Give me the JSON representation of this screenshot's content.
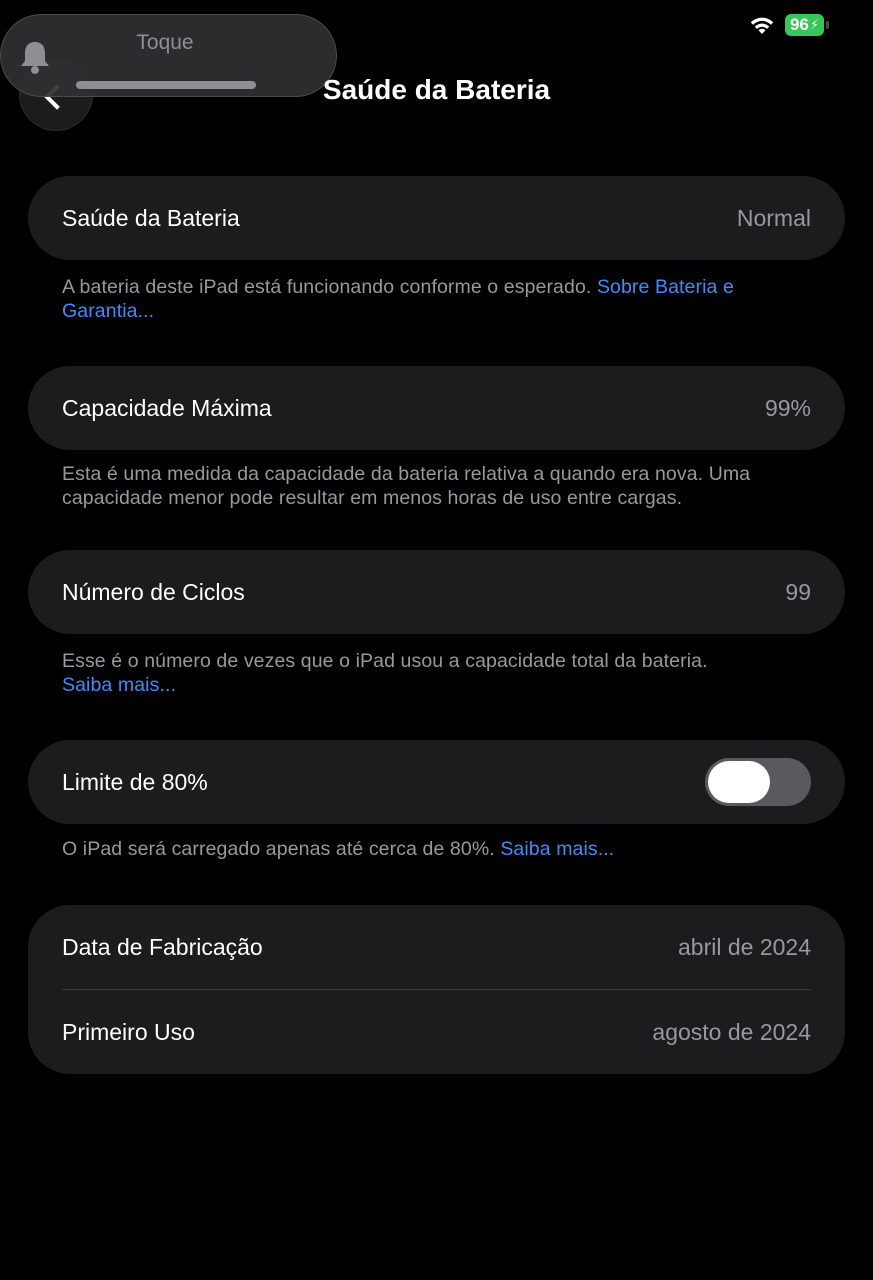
{
  "status_bar": {
    "battery_percent": "96",
    "wifi_icon": "wifi-icon",
    "charging_icon": "bolt-icon"
  },
  "banner": {
    "label": "Toque",
    "icon": "bell-icon",
    "volume_level": 1.0
  },
  "header": {
    "title": "Saúde da Bateria",
    "back_icon": "chevron-left-icon"
  },
  "sections": {
    "health": {
      "label": "Saúde da Bateria",
      "value": "Normal",
      "footnote": "A bateria deste iPad está funcionando conforme o esperado. ",
      "footnote_link": "Sobre Bateria e Garantia..."
    },
    "capacity": {
      "label": "Capacidade Máxima",
      "value": "99%",
      "footnote": "Esta é uma medida da capacidade da bateria relativa a quando era nova. Uma capacidade menor pode resultar em menos horas de uso entre cargas."
    },
    "cycles": {
      "label": "Número de Ciclos",
      "value": "99",
      "footnote": "Esse é o número de vezes que o iPad usou a capacidade total da bateria.",
      "footnote_link": "Saiba mais..."
    },
    "limit": {
      "label": "Limite de 80%",
      "toggle_on": false,
      "footnote": "O iPad será carregado apenas até cerca de 80%. ",
      "footnote_link": "Saiba mais..."
    },
    "dates": {
      "manufacture_label": "Data de Fabricação",
      "manufacture_value": "abril de 2024",
      "first_use_label": "Primeiro Uso",
      "first_use_value": "agosto de 2024"
    }
  },
  "colors": {
    "background": "#000000",
    "card": "#1c1c1e",
    "link": "#3e8cff",
    "battery": "#34c759"
  }
}
